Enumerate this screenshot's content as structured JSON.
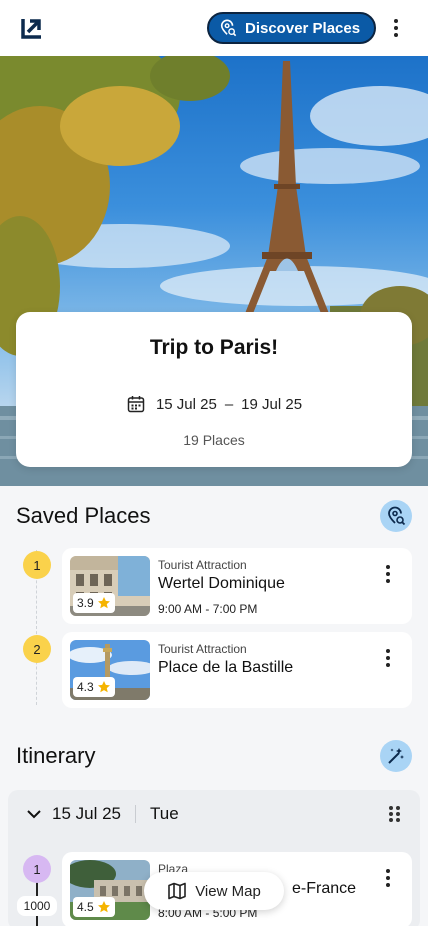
{
  "header": {
    "logo_icon": "share-arrow-icon",
    "discover_label": "Discover Places",
    "discover_icon": "map-pin-search-icon",
    "more_icon": "more-vertical-icon"
  },
  "trip": {
    "title": "Trip to Paris!",
    "start_date": "15 Jul 25",
    "date_separator": "–",
    "end_date": "19 Jul 25",
    "places_count": "19 Places"
  },
  "saved_places": {
    "title": "Saved Places",
    "action_icon": "map-pin-search-icon",
    "items": [
      {
        "number": "1",
        "category": "Tourist Attraction",
        "name": "Wertel Dominique",
        "hours": "9:00 AM - 7:00 PM",
        "rating": "3.9"
      },
      {
        "number": "2",
        "category": "Tourist Attraction",
        "name": "Place de la Bastille",
        "hours": "",
        "rating": "4.3"
      }
    ]
  },
  "itinerary": {
    "title": "Itinerary",
    "action_icon": "magic-wand-icon",
    "day": {
      "date": "15 Jul 25",
      "weekday": "Tue"
    },
    "items": [
      {
        "number": "1",
        "category": "Plaza",
        "name": "e-France",
        "hours": "8:00 AM - 5:00 PM",
        "rating": "4.5",
        "distance": "1000"
      }
    ]
  },
  "view_map_label": "View Map",
  "colors": {
    "primary": "#0b5aa6",
    "accent_light": "#a9d4f5",
    "badge_yellow": "#fad24b",
    "badge_purple": "#d7b8f2",
    "star": "#f5b400"
  }
}
